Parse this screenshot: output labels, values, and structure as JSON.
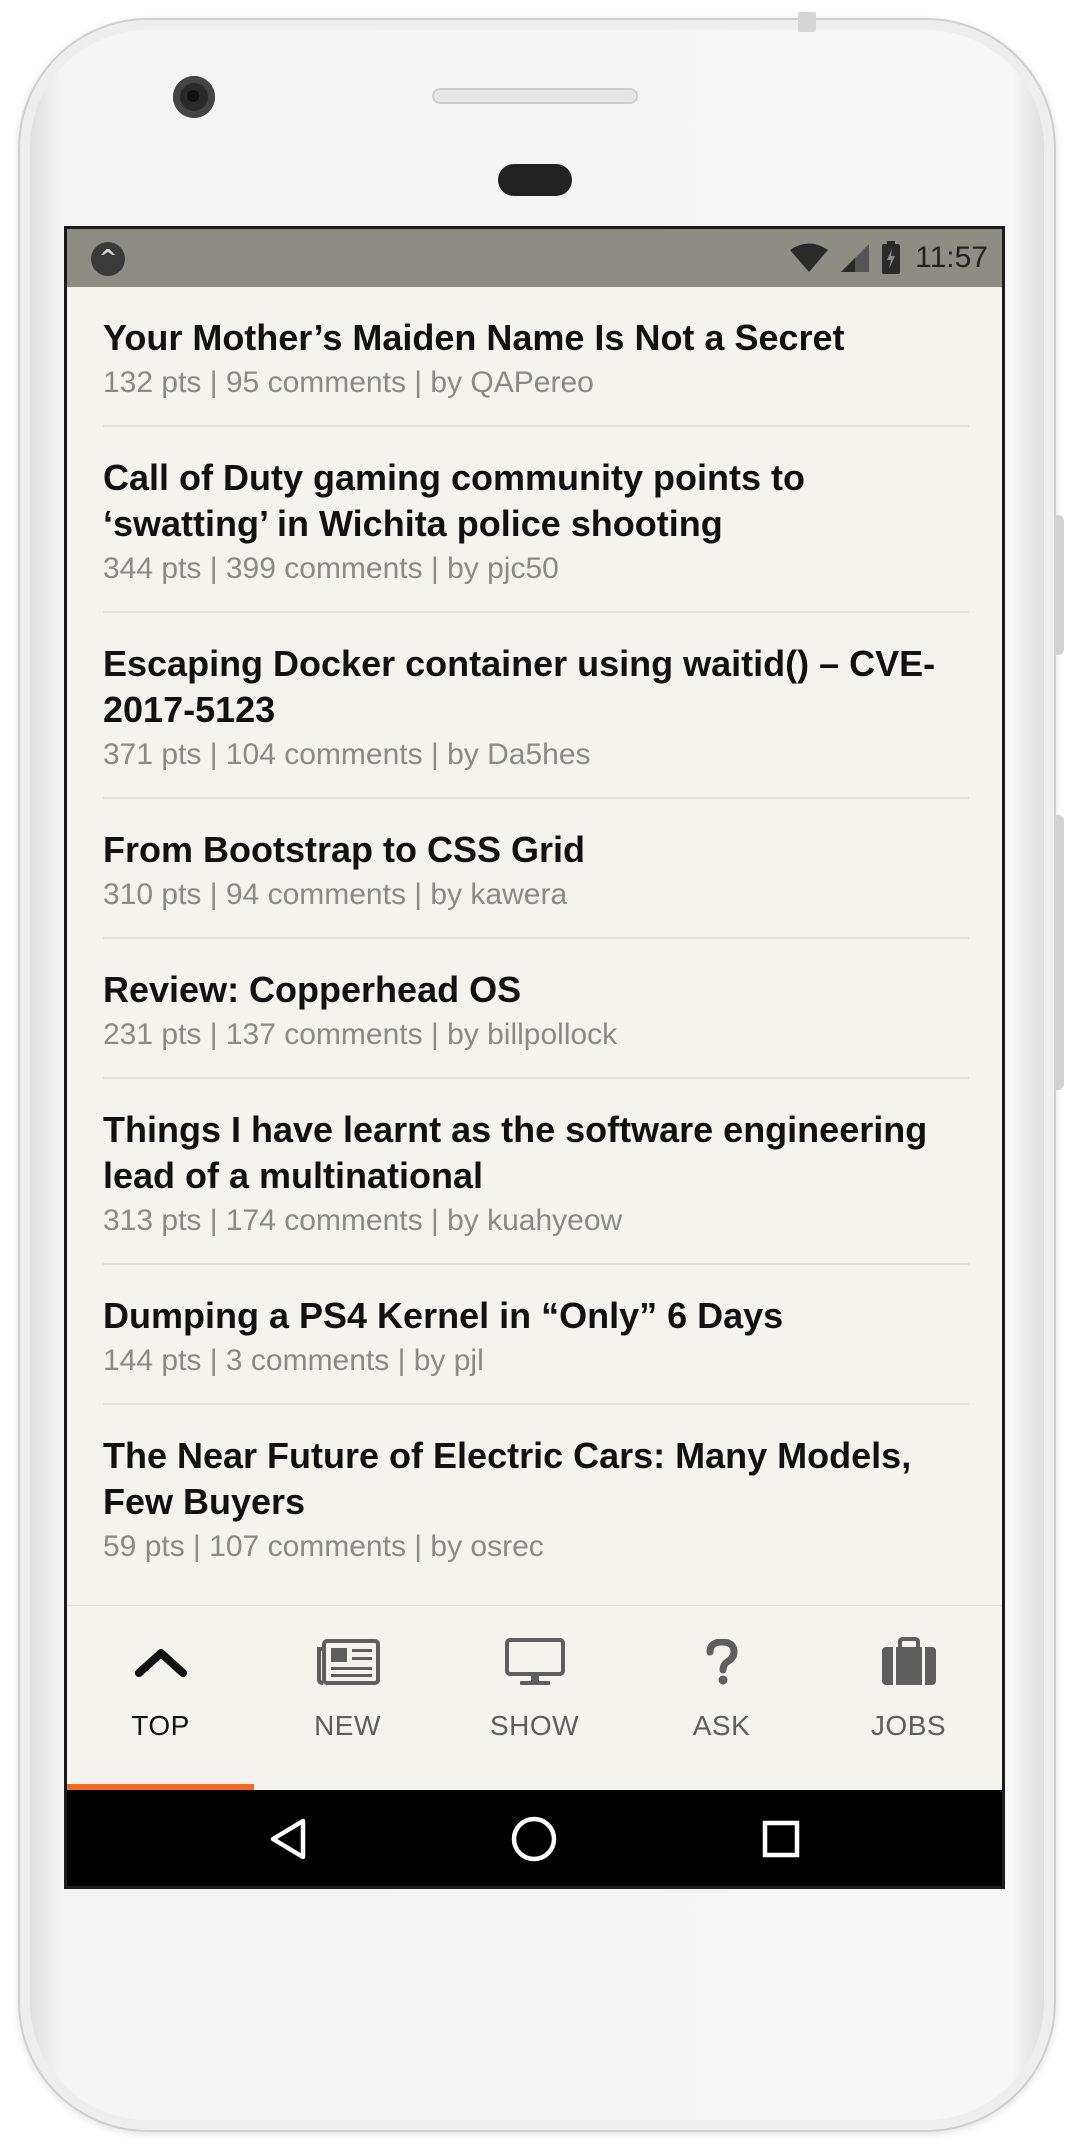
{
  "status_bar": {
    "time": "11:57",
    "app_logo_icon": "caret-up-circle-icon",
    "icons": [
      "wifi-icon",
      "cell-signal-icon",
      "battery-charging-icon"
    ]
  },
  "stories": [
    {
      "title": "Your Mother’s Maiden Name Is Not a Secret",
      "meta": "132 pts | 95 comments | by QAPereo"
    },
    {
      "title": "Call of Duty gaming community points to ‘swatting’ in Wichita police shooting",
      "meta": "344 pts | 399 comments | by pjc50"
    },
    {
      "title": "Escaping Docker container using waitid() – CVE-2017-5123",
      "meta": "371 pts | 104 comments | by Da5hes"
    },
    {
      "title": "From Bootstrap to CSS Grid",
      "meta": "310 pts | 94 comments | by kawera"
    },
    {
      "title": "Review: Copperhead OS",
      "meta": "231 pts | 137 comments | by billpollock"
    },
    {
      "title": "Things I have learnt as the software engineering lead of a multinational",
      "meta": "313 pts | 174 comments | by kuahyeow"
    },
    {
      "title": "Dumping a PS4 Kernel in “Only” 6 Days",
      "meta": "144 pts | 3 comments | by pjl"
    },
    {
      "title": "The Near Future of Electric Cars: Many Models, Few Buyers",
      "meta": "59 pts | 107 comments | by osrec"
    }
  ],
  "tabs": [
    {
      "label": "TOP",
      "icon": "chevron-up-icon",
      "active": true
    },
    {
      "label": "NEW",
      "icon": "newspaper-icon",
      "active": false
    },
    {
      "label": "SHOW",
      "icon": "monitor-icon",
      "active": false
    },
    {
      "label": "ASK",
      "icon": "question-icon",
      "active": false
    },
    {
      "label": "JOBS",
      "icon": "briefcase-icon",
      "active": false
    }
  ],
  "nav_bar": {
    "icons": [
      "back-triangle-icon",
      "home-circle-icon",
      "recents-square-icon"
    ]
  },
  "colors": {
    "accent": "#f06a1f",
    "background": "#f4f3ee",
    "status_bar": "#8d8d84",
    "title_text": "#111111",
    "meta_text": "#8a8a86"
  }
}
